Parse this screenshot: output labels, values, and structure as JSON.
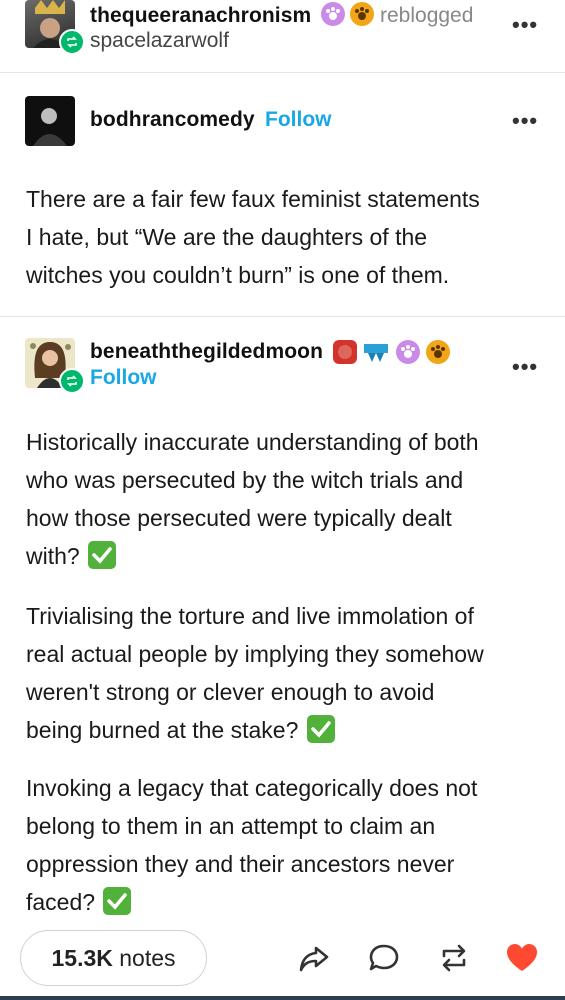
{
  "reblog_header": {
    "user": "thequeeranachronism",
    "action": "reblogged",
    "source": "spacelazarwolf"
  },
  "post1": {
    "user": "bodhrancomedy",
    "follow": "Follow",
    "lines": [
      "There are a fair few faux feminist statements",
      "I hate, but “We are the daughters of the",
      "witches you couldn’t burn” is one of them."
    ]
  },
  "post2": {
    "user": "beneaththegildedmoon",
    "follow": "Follow",
    "paragraphs": [
      [
        "Historically inaccurate understanding of both",
        "who was persecuted by the witch trials and",
        "how those persecuted were typically dealt",
        "with?"
      ],
      [
        "Trivialising the torture and live immolation of",
        "real actual people by implying they somehow",
        "weren't strong or clever enough to avoid",
        "being burned at the stake?"
      ],
      [
        "Invoking a legacy that categorically does not",
        "belong to them in an attempt to claim an",
        "oppression they and their ancestors never",
        "faced?"
      ]
    ]
  },
  "footer": {
    "notes_count": "15.3K",
    "notes_label": "notes"
  },
  "colors": {
    "follow": "#1aa7e5",
    "reblog_green": "#00b86b",
    "like_red": "#ff4930",
    "check_green": "#52b13a"
  },
  "icons": [
    "reblog-icon",
    "more-icon",
    "share-icon",
    "comment-icon",
    "reblog-action-icon",
    "heart-icon",
    "check-icon"
  ]
}
